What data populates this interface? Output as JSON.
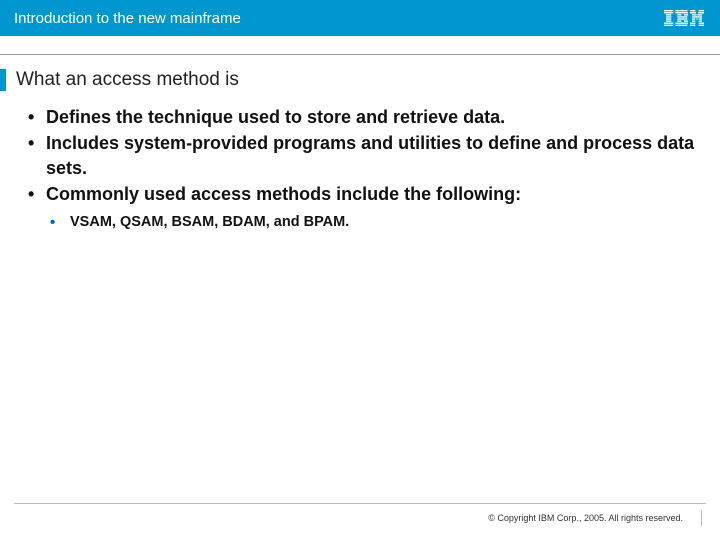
{
  "header": {
    "title": "Introduction to the new mainframe",
    "logo_name": "IBM"
  },
  "slide": {
    "title": "What an access method is"
  },
  "bullets": [
    {
      "text": "Defines the technique used to store and retrieve data."
    },
    {
      "text": "Includes system-provided programs and utilities to define and process data sets."
    },
    {
      "text": "Commonly used access methods include the following:",
      "sub": [
        {
          "text": "VSAM, QSAM, BSAM, BDAM, and BPAM."
        }
      ]
    }
  ],
  "footer": {
    "copyright": "© Copyright IBM Corp., 2005. All rights reserved."
  }
}
